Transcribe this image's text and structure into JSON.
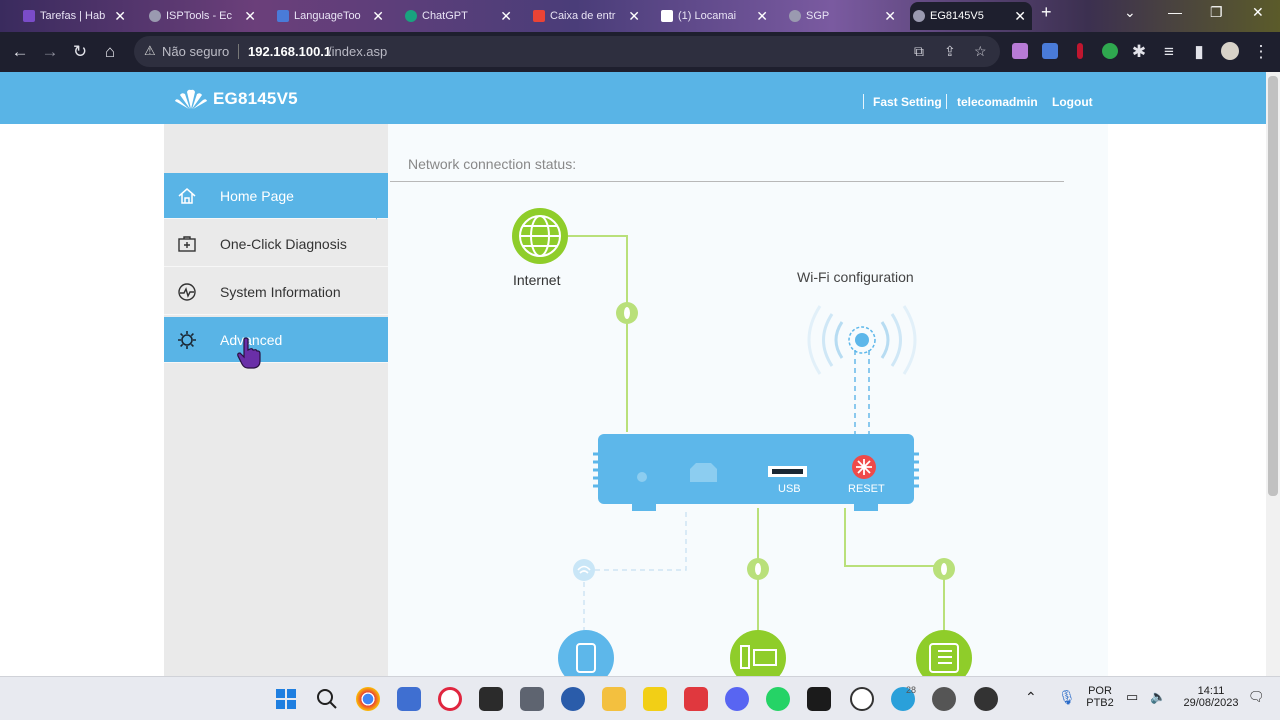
{
  "browser": {
    "tabs": [
      {
        "title": "Tarefas | Hab",
        "icon": "tasks-favicon",
        "color": "#7a4cc9"
      },
      {
        "title": "ISPTools - Ec",
        "icon": "globe-favicon",
        "color": "#9a9ab0"
      },
      {
        "title": "LanguageToo",
        "icon": "languagetool-favicon",
        "color": "#4a7bd8"
      },
      {
        "title": "ChatGPT",
        "icon": "chatgpt-favicon",
        "color": "#19a37f"
      },
      {
        "title": "Caixa de entr",
        "icon": "gmail-favicon",
        "color": "#ea4335"
      },
      {
        "title": "(1) Locamai",
        "icon": "w-favicon",
        "color": "#c0162f"
      },
      {
        "title": "SGP",
        "icon": "sgp-favicon",
        "color": "#9a9ab0"
      },
      {
        "title": "EG8145V5",
        "icon": "globe-favicon",
        "color": "#9a9ab0",
        "active": true
      }
    ],
    "new_tab": "+",
    "address": {
      "security": "Não seguro",
      "host": "192.168.100.1",
      "path": "/index.asp"
    }
  },
  "router": {
    "model": "EG8145V5",
    "header_links": {
      "fast_setting": "Fast Setting",
      "user": "telecomadmin",
      "logout": "Logout"
    },
    "nav": [
      {
        "label": "Home Page",
        "icon": "home-icon",
        "selected": true
      },
      {
        "label": "One-Click Diagnosis",
        "icon": "first-aid-kit-icon"
      },
      {
        "label": "System Information",
        "icon": "pulse-icon"
      },
      {
        "label": "Advanced",
        "icon": "gear-icon",
        "hovered": true
      }
    ],
    "content_title": "Network connection status:",
    "diagram": {
      "internet_label": "Internet",
      "wifi_label": "Wi-Fi configuration",
      "usb_label": "USB",
      "reset_label": "RESET"
    }
  },
  "colors": {
    "header_blue": "#59b4e6",
    "green_node": "#8fcd2a",
    "light_green_link": "#b9e07a",
    "router_blue": "#5db7ea",
    "reset_red": "#ef4a4a"
  },
  "taskbar": {
    "language": "POR",
    "layout": "PTB2",
    "time": "14:11",
    "date": "29/08/2023",
    "notification_badge": "28"
  }
}
